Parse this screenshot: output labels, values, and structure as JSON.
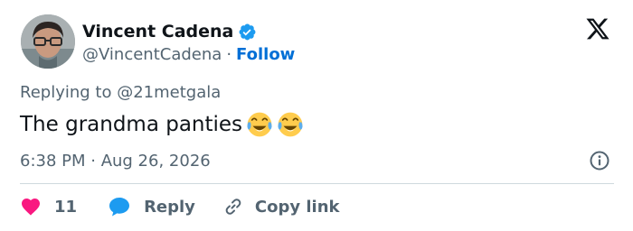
{
  "tweet": {
    "author": {
      "display_name": "Vincent Cadena",
      "handle": "@VincentCadena",
      "separator": "·",
      "follow_label": "Follow",
      "verified": true,
      "avatar_icon": "avatar"
    },
    "replying_prefix": "Replying to",
    "replying_to": "@21metgala",
    "text": "The grandma panties",
    "emojis": [
      "face-with-tears-of-joy-icon",
      "face-with-tears-of-joy-icon"
    ],
    "timestamp": "6:38 PM · Aug 26, 2026",
    "actions": {
      "like_count": "11",
      "reply_label": "Reply",
      "copy_label": "Copy link"
    },
    "colors": {
      "accent": "#1d9bf0",
      "follow": "#006fd6",
      "like": "#f91880",
      "muted": "#536471",
      "text": "#0f1419"
    }
  }
}
